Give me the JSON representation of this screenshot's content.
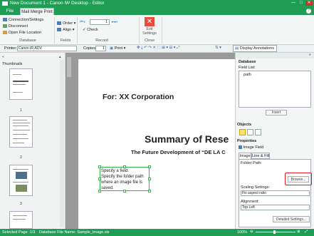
{
  "window": {
    "title": "New Document 1 - Canon iW Desktop - Editor",
    "min": "—",
    "max": "□",
    "close": "✕"
  },
  "tabs": {
    "file": "File",
    "mail_merge": "Mail Merge Print"
  },
  "ribbon": {
    "database": {
      "connection": "Connection/Settings",
      "disconnect": "Disconnect",
      "open_file_location": "Open File Location",
      "label": "Database"
    },
    "fields": {
      "order": "Order",
      "align": "Align",
      "label": "Fields"
    },
    "record": {
      "value": "1",
      "check": "Check",
      "label": "Record"
    },
    "close": {
      "exit": "Exit Settings",
      "label": "Close"
    }
  },
  "toolbar": {
    "printer_label": "Printer:",
    "printer_value": "Canon iR-ADV",
    "copies_label": "Copies:",
    "copies_value": "1",
    "print_label": "Print",
    "display_annotations": "Display Annotations"
  },
  "left_pane": {
    "title": "Thumbnails",
    "pages": [
      "1",
      "2",
      "3"
    ]
  },
  "document": {
    "for_line": "For: XX Corporation",
    "summary": "Summary of Rese",
    "subtitle": "The Future Development of “DE LA C",
    "field_text": "Specify a field.\nSpecify the folder path where an image file is saved."
  },
  "right_pane": {
    "database_header": "Database",
    "field_list_label": "Field List:",
    "field_item": "path",
    "insert_button": "Insert",
    "objects_header": "Objects",
    "properties_header": "Properties",
    "image_field_label": "Image Field",
    "tab_image": "Image",
    "tab_line_fill": "Line & Fill",
    "folder_path_label": "Folder Path:",
    "browse_button": "Browse...",
    "scaling_label": "Scaling Settings:",
    "scaling_value": "Fix aspect ratio",
    "alignment_label": "Alignment:",
    "alignment_value": "Top Left",
    "detailed_button": "Detailed Settings..."
  },
  "status": {
    "selected_page": "Selected Page :1/3",
    "database_file": "Database File Name: Sample_Image.xls",
    "zoom": "100%"
  },
  "colors": {
    "accent": "#1f9d55",
    "highlight": "#e31c23",
    "selection": "#3ab54a"
  }
}
